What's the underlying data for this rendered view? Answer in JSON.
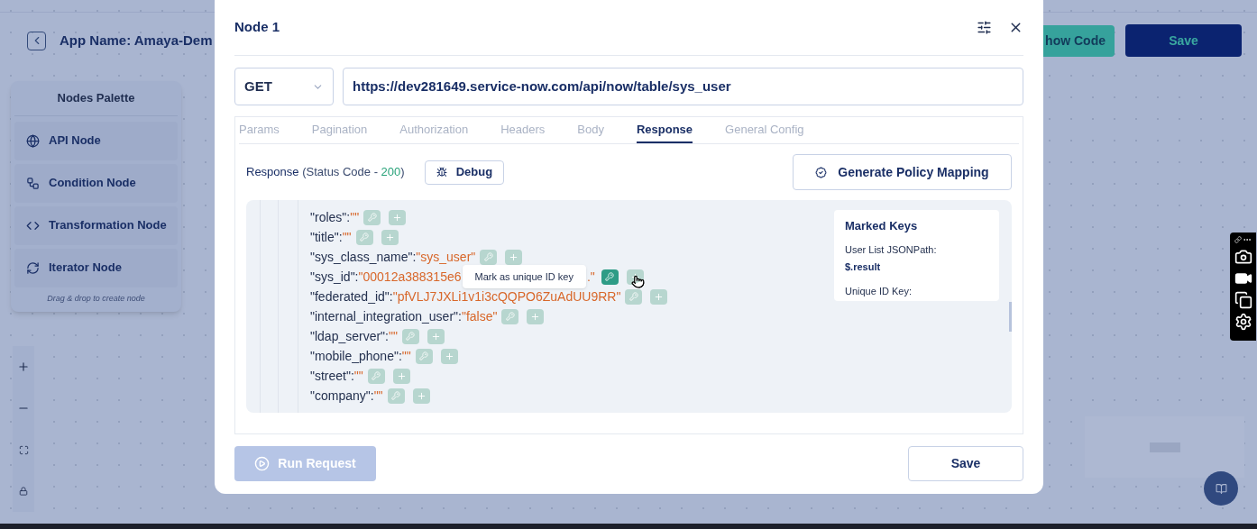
{
  "app": {
    "title": "App Name: Amaya-Dem",
    "show_code": "how Code",
    "save": "Save"
  },
  "palette": {
    "title": "Nodes Palette",
    "items": [
      {
        "kind": "api",
        "label": "API Node"
      },
      {
        "kind": "condition",
        "label": "Condition Node"
      },
      {
        "kind": "transformation",
        "label": "Transformation Node"
      },
      {
        "kind": "iterator",
        "label": "Iterator Node"
      }
    ],
    "hint": "Drag & drop to create node"
  },
  "modal": {
    "title": "Node 1",
    "method": "GET",
    "url": "https://dev281649.service-now.com/api/now/table/sys_user",
    "tabs": [
      {
        "label": "Params",
        "selected": false
      },
      {
        "label": "Pagination",
        "selected": false
      },
      {
        "label": "Authorization",
        "selected": false
      },
      {
        "label": "Headers",
        "selected": false
      },
      {
        "label": "Body",
        "selected": false
      },
      {
        "label": "Response",
        "selected": true
      },
      {
        "label": "General Config",
        "selected": false
      }
    ],
    "response_label": "Response",
    "status_prefix": "(Status Code - ",
    "status_code": "200",
    "status_suffix": ")",
    "debug": "Debug",
    "generate": "Generate Policy Mapping",
    "rows": [
      {
        "key": "\"roles\":",
        "value": "\"\"",
        "key_active": false
      },
      {
        "key": "\"title\":",
        "value": "\"\"",
        "key_active": false
      },
      {
        "key": "\"sys_class_name\":",
        "value": "\"sys_user\"",
        "key_active": false
      },
      {
        "key": "\"sys_id\":",
        "value": "\"00012a388315e6",
        "tooltip": "Mark as unique ID key",
        "tail": ".\"",
        "key_active": true
      },
      {
        "key": "\"federated_id\":",
        "value": "\"pfVLJ7JXLi1v1i3cQQPO6ZuAdUU9RR\"",
        "key_active": false
      },
      {
        "key": "\"internal_integration_user\":",
        "value": "\"false\"",
        "key_active": false
      },
      {
        "key": "\"ldap_server\":",
        "value": "\"\"",
        "key_active": false
      },
      {
        "key": "\"mobile_phone\":",
        "value": "\"\"",
        "key_active": false
      },
      {
        "key": "\"street\":",
        "value": "\"\"",
        "key_active": false
      },
      {
        "key": "\"company\":",
        "value": "\"\"",
        "key_active": false
      }
    ],
    "marked_keys": {
      "title": "Marked Keys",
      "path_label": "User List JSONPath:",
      "path_value": "$.result",
      "unique_label": "Unique ID Key:"
    },
    "run": "Run Request",
    "run_disabled": true,
    "save": "Save"
  }
}
